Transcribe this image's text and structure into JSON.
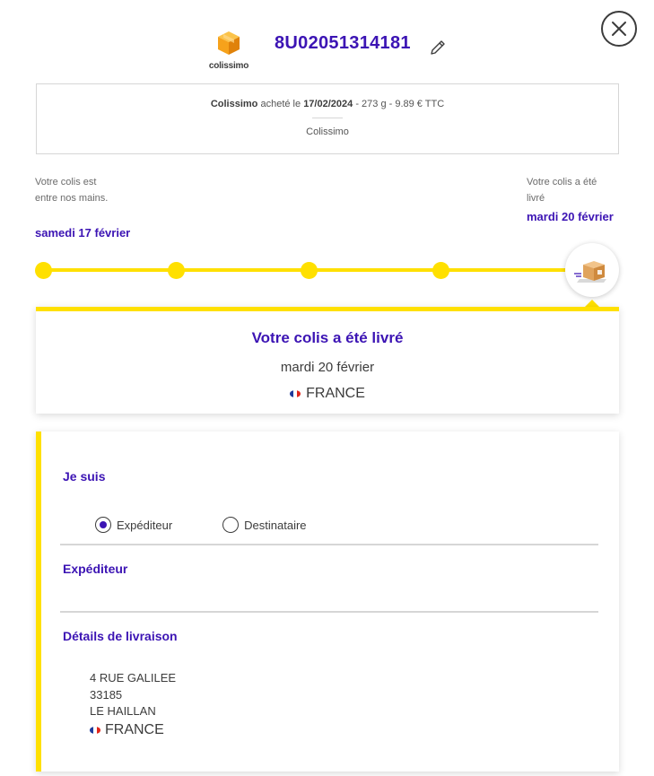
{
  "header": {
    "logo_text": "colissimo",
    "tracking_number": "8U02051314181"
  },
  "summary": {
    "carrier_bold": "Colissimo",
    "purchased_label": "acheté le",
    "purchase_date": "17/02/2024",
    "details": "- 273 g - 9.89 € TTC",
    "carrier": "Colissimo"
  },
  "timeline": {
    "start": {
      "status": "Votre colis est entre nos mains.",
      "date": "samedi 17 février"
    },
    "end": {
      "status": "Votre colis a été livré",
      "date": "mardi 20 février"
    },
    "steps_total": 5,
    "current_step": 5
  },
  "status": {
    "title": "Votre colis a été livré",
    "date": "mardi 20 février",
    "country": "FRANCE"
  },
  "role": {
    "title": "Je suis",
    "options": [
      {
        "label": "Expéditeur",
        "selected": true
      },
      {
        "label": "Destinataire",
        "selected": false
      }
    ]
  },
  "sender": {
    "title": "Expéditeur"
  },
  "delivery": {
    "title": "Détails de livraison",
    "street": "4 RUE GALILEE",
    "postal_code": "33185",
    "city": "LE HAILLAN",
    "country": "FRANCE"
  },
  "colors": {
    "accent_yellow": "#ffe000",
    "brand_purple": "#3c14b4",
    "logo_orange": "#f6a21b"
  },
  "icons": {
    "close": "close-icon",
    "edit": "pencil-icon",
    "delivered": "package-icon",
    "logo": "colissimo-box-logo",
    "flag": "france-flag-icon"
  }
}
